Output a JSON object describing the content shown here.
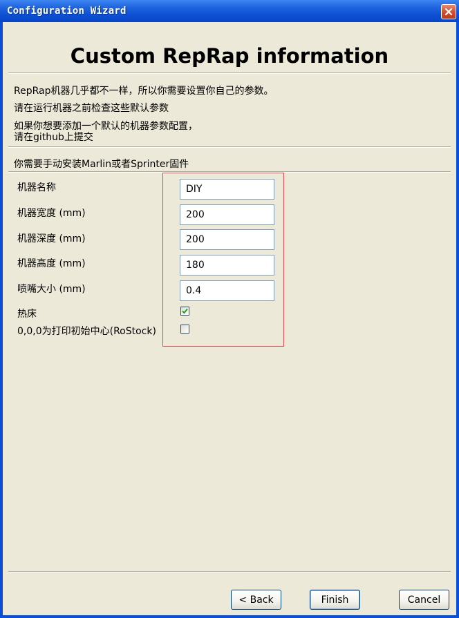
{
  "window": {
    "title": "Configuration Wizard",
    "close_icon": "close-icon"
  },
  "page": {
    "heading": "Custom RepRap information",
    "intro_line1": "RepRap机器几乎都不一样，所以你需要设置你自己的参数。",
    "intro_line2": "请在运行机器之前检查这些默认参数",
    "intro_line3": "如果你想要添加一个默认的机器参数配置，",
    "intro_line4": "请在github上提交",
    "firmware_note": "你需要手动安装Marlin或者Sprinter固件"
  },
  "form": {
    "machine_name_label": "机器名称",
    "machine_name_value": "DIY",
    "machine_width_label": "机器宽度 (mm)",
    "machine_width_value": "200",
    "machine_depth_label": "机器深度 (mm)",
    "machine_depth_value": "200",
    "machine_height_label": "机器高度 (mm)",
    "machine_height_value": "180",
    "nozzle_size_label": "喷嘴大小 (mm)",
    "nozzle_size_value": "0.4",
    "heated_bed_label": "热床",
    "heated_bed_checked": true,
    "center_origin_label": "0,0,0为打印初始中心(RoStock)",
    "center_origin_checked": false
  },
  "buttons": {
    "back_label": "< Back",
    "finish_label": "Finish",
    "cancel_label": "Cancel"
  },
  "colors": {
    "titlebar": "#0c4fd1",
    "dialog_bg": "#ece9d8",
    "annotation_box": "#e0484e",
    "check_mark": "#21a121"
  }
}
